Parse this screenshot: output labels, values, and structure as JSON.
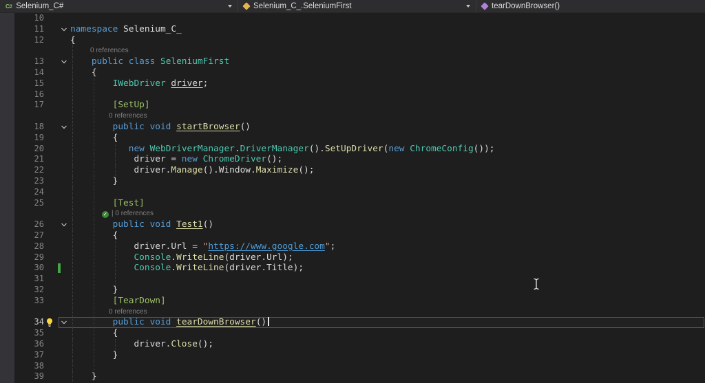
{
  "navbar": {
    "project_label": "Selenium_C#",
    "type_label": "Selenium_C_.SeleniumFirst",
    "member_label": "tearDownBrowser()"
  },
  "theme": {
    "editor-bg": "#1E1E1E",
    "navbar-bg": "#2D2D30",
    "gutter-bg": "#333338",
    "line-number": "#858585",
    "fg": "#DCDCDC",
    "kw": "#569CD6",
    "type": "#4EC9B0",
    "method": "#DCDCAA",
    "attr": "#9CC069",
    "str": "#D69D85",
    "url": "#4E9CD6",
    "lens": "#808080",
    "pass-green": "#388A34",
    "change-green": "#44A944",
    "guide": "#3E3E46",
    "curline-border": "#57575C",
    "caret": "#E6E6E6"
  },
  "editor": {
    "rows": [
      {
        "n": 10,
        "guides": [],
        "tokens": []
      },
      {
        "n": 11,
        "fold": true,
        "guides": [],
        "tokens": [
          [
            "kw",
            "namespace"
          ],
          [
            "pl",
            " Selenium_C_"
          ]
        ]
      },
      {
        "n": 12,
        "guides": [],
        "tokens": [
          [
            "pl",
            "{"
          ]
        ]
      },
      {
        "lens": "0 references",
        "indent": 131,
        "guides": [
          0
        ]
      },
      {
        "n": 13,
        "fold": true,
        "guides": [
          0
        ],
        "tokens": [
          [
            "kw",
            "    public class"
          ],
          [
            "type",
            " SeleniumFirst"
          ]
        ]
      },
      {
        "n": 14,
        "guides": [
          0
        ],
        "tokens": [
          [
            "pl",
            "    {"
          ]
        ]
      },
      {
        "n": 15,
        "guides": [
          0,
          4
        ],
        "tokens": [
          [
            "pl",
            "        "
          ],
          [
            "type",
            "IWebDriver"
          ],
          [
            "pl",
            " "
          ],
          [
            "und",
            "driver"
          ],
          [
            "pl",
            ";"
          ]
        ]
      },
      {
        "n": 16,
        "guides": [
          0,
          4
        ],
        "tokens": []
      },
      {
        "n": 17,
        "guides": [
          0,
          4
        ],
        "tokens": [
          [
            "pl",
            "        "
          ],
          [
            "attr",
            "[SetUp]"
          ]
        ]
      },
      {
        "lens": "0 references",
        "indent": 158,
        "guides": [
          0,
          4
        ]
      },
      {
        "n": 18,
        "fold": true,
        "guides": [
          0,
          4
        ],
        "tokens": [
          [
            "kw",
            "        public void"
          ],
          [
            "pl",
            " "
          ],
          [
            "mund",
            "startBrowser"
          ],
          [
            "pl",
            "()"
          ]
        ]
      },
      {
        "n": 19,
        "guides": [
          0,
          4
        ],
        "tokens": [
          [
            "pl",
            "        {"
          ]
        ]
      },
      {
        "n": 20,
        "guides": [
          0,
          4,
          8
        ],
        "tokens": [
          [
            "pl",
            "           "
          ],
          [
            "kw",
            "new"
          ],
          [
            "pl",
            " "
          ],
          [
            "type",
            "WebDriverManager"
          ],
          [
            "pl",
            "."
          ],
          [
            "type",
            "DriverManager"
          ],
          [
            "pl",
            "()."
          ],
          [
            "m",
            "SetUpDriver"
          ],
          [
            "pl",
            "("
          ],
          [
            "kw",
            "new"
          ],
          [
            "pl",
            " "
          ],
          [
            "type",
            "ChromeConfig"
          ],
          [
            "pl",
            "());"
          ]
        ]
      },
      {
        "n": 21,
        "guides": [
          0,
          4,
          8
        ],
        "tokens": [
          [
            "pl",
            "            driver = "
          ],
          [
            "kw",
            "new"
          ],
          [
            "pl",
            " "
          ],
          [
            "type",
            "ChromeDriver"
          ],
          [
            "pl",
            "();"
          ]
        ]
      },
      {
        "n": 22,
        "guides": [
          0,
          4,
          8
        ],
        "tokens": [
          [
            "pl",
            "            driver."
          ],
          [
            "m",
            "Manage"
          ],
          [
            "pl",
            "()."
          ],
          [
            "pl",
            "Window."
          ],
          [
            "m",
            "Maximize"
          ],
          [
            "pl",
            "();"
          ]
        ]
      },
      {
        "n": 23,
        "guides": [
          0,
          4
        ],
        "tokens": [
          [
            "pl",
            "        }"
          ]
        ]
      },
      {
        "n": 24,
        "guides": [
          0,
          4
        ],
        "tokens": []
      },
      {
        "n": 25,
        "guides": [
          0,
          4
        ],
        "tokens": [
          [
            "pl",
            "        "
          ],
          [
            "attr",
            "[Test]"
          ]
        ]
      },
      {
        "lens": "| 0 references",
        "check": true,
        "indent": 148,
        "guides": [
          0,
          4
        ]
      },
      {
        "n": 26,
        "fold": true,
        "guides": [
          0,
          4
        ],
        "tokens": [
          [
            "kw",
            "        public void"
          ],
          [
            "pl",
            " "
          ],
          [
            "mund",
            "Test1"
          ],
          [
            "pl",
            "()"
          ]
        ]
      },
      {
        "n": 27,
        "guides": [
          0,
          4
        ],
        "tokens": [
          [
            "pl",
            "        {"
          ]
        ]
      },
      {
        "n": 28,
        "guides": [
          0,
          4,
          8
        ],
        "tokens": [
          [
            "pl",
            "            driver.Url = "
          ],
          [
            "str",
            "\""
          ],
          [
            "url",
            "https://www.google.com"
          ],
          [
            "str",
            "\""
          ],
          [
            "pl",
            ";"
          ]
        ]
      },
      {
        "n": 29,
        "guides": [
          0,
          4,
          8
        ],
        "tokens": [
          [
            "pl",
            "            "
          ],
          [
            "type",
            "Console"
          ],
          [
            "pl",
            "."
          ],
          [
            "m",
            "WriteLine"
          ],
          [
            "pl",
            "(driver.Url);"
          ]
        ]
      },
      {
        "n": 30,
        "changebar": true,
        "guides": [
          0,
          4,
          8
        ],
        "tokens": [
          [
            "pl",
            "            "
          ],
          [
            "type",
            "Console"
          ],
          [
            "pl",
            "."
          ],
          [
            "m",
            "WriteLine"
          ],
          [
            "pl",
            "(driver.Title);"
          ]
        ]
      },
      {
        "n": 31,
        "guides": [
          0,
          4,
          8
        ],
        "tokens": []
      },
      {
        "n": 32,
        "guides": [
          0,
          4
        ],
        "tokens": [
          [
            "pl",
            "        }"
          ]
        ]
      },
      {
        "n": 33,
        "guides": [
          0,
          4
        ],
        "tokens": [
          [
            "pl",
            "        "
          ],
          [
            "attr",
            "[TearDown]"
          ]
        ]
      },
      {
        "lens": "0 references",
        "indent": 158,
        "guides": [
          0,
          4
        ]
      },
      {
        "n": 34,
        "fold": true,
        "bulb": true,
        "current": true,
        "caret": true,
        "guides": [
          0,
          4
        ],
        "tokens": [
          [
            "kw",
            "        public void"
          ],
          [
            "pl",
            " "
          ],
          [
            "mund",
            "tearDownBrowser"
          ],
          [
            "pl",
            "()"
          ]
        ]
      },
      {
        "n": 35,
        "guides": [
          0,
          4
        ],
        "tokens": [
          [
            "pl",
            "        {"
          ]
        ]
      },
      {
        "n": 36,
        "guides": [
          0,
          4,
          8
        ],
        "tokens": [
          [
            "pl",
            "            driver."
          ],
          [
            "m",
            "Close"
          ],
          [
            "pl",
            "();"
          ]
        ]
      },
      {
        "n": 37,
        "guides": [
          0,
          4
        ],
        "tokens": [
          [
            "pl",
            "        }"
          ]
        ]
      },
      {
        "n": 38,
        "guides": [
          0,
          4
        ],
        "tokens": []
      },
      {
        "n": 39,
        "guides": [
          0
        ],
        "tokens": [
          [
            "pl",
            "    }"
          ]
        ]
      }
    ]
  }
}
